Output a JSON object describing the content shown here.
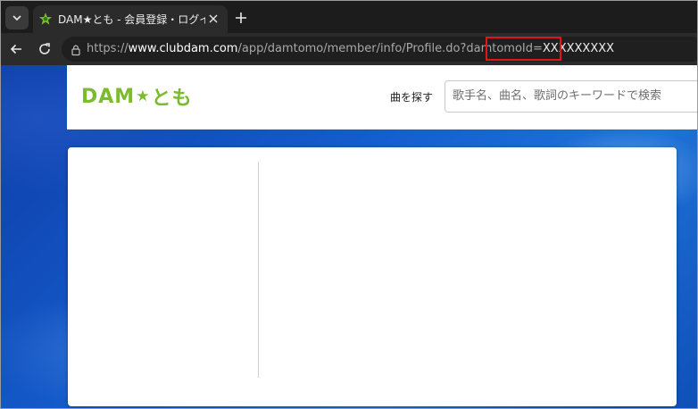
{
  "browser": {
    "tab": {
      "title": "DAM★とも - 会員登録・ログイン｜カラ",
      "favicon": "dam-tomo-favicon"
    },
    "url": {
      "prefix": "https://",
      "host": "www.clubdam.com",
      "path": "/app/damtomo/member/info/Profile.do?damtomoId=",
      "query_value": "XXXXXXXXX"
    }
  },
  "site": {
    "logo": {
      "text_left": "DAM",
      "star": "★",
      "text_right": "とも"
    },
    "search": {
      "label": "曲を探す",
      "placeholder": "歌手名、曲名、歌詞のキーワードで検索"
    }
  },
  "colors": {
    "brand_green": "#7cbb2c",
    "highlight_red": "#e2151a",
    "browser_dark": "#2b2b2b",
    "page_blue": "#155fd0"
  }
}
